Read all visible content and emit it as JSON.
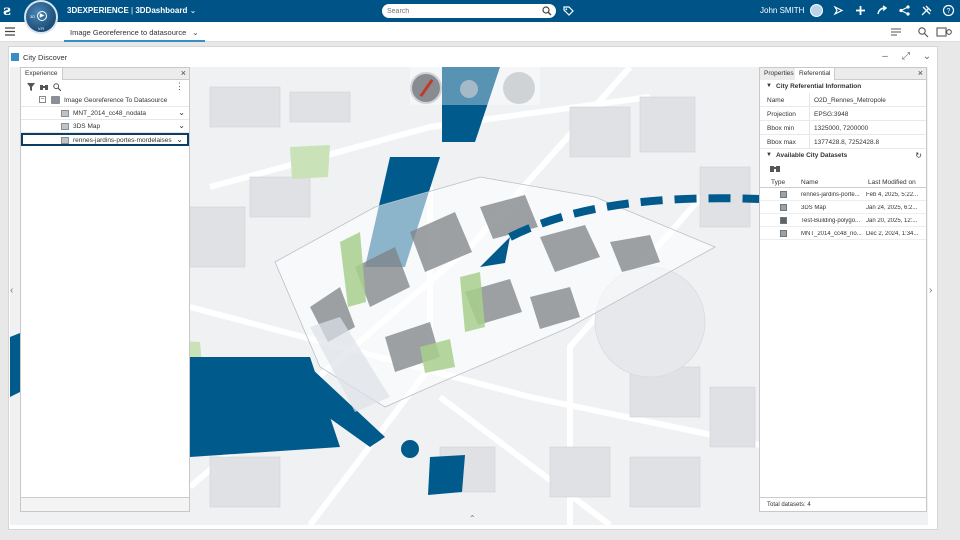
{
  "app": {
    "brand_prefix": "3DEXPERIENCE",
    "brand_separator": " | ",
    "brand_app": "3DDashboard",
    "compass_label": "3D",
    "compass_version": "V.R"
  },
  "search": {
    "placeholder": "Search"
  },
  "user": {
    "name": "John SMITH"
  },
  "dashboard_tab": {
    "label": "Image Georeference to datasource"
  },
  "widget": {
    "title": "City Discover"
  },
  "experience_panel": {
    "tab_label": "Experience",
    "tree": {
      "root": "Image Georeference To Datasource",
      "children": [
        {
          "label": "MNT_2014_cc48_nodata"
        },
        {
          "label": "3DS Map"
        },
        {
          "label": "rennes-jardins-portes-mordelaises"
        }
      ]
    }
  },
  "referential_panel": {
    "tabs": [
      "Properties",
      "Referential"
    ],
    "section_info": "City Referential Information",
    "info": [
      {
        "key": "Name",
        "value": "O2D_Rennes_Metropole"
      },
      {
        "key": "Projection",
        "value": "EPSG:3948"
      },
      {
        "key": "Bbox min",
        "value": "1325000, 7200000"
      },
      {
        "key": "Bbox max",
        "value": "1377428.8, 7252428.8"
      }
    ],
    "section_datasets": "Available City Datasets",
    "columns": [
      "Type",
      "Name",
      "Last Modified on"
    ],
    "datasets": [
      {
        "name": "rennes-jardins-porte...",
        "modified": "Feb 4, 2025, 5:22..."
      },
      {
        "name": "3DS Map",
        "modified": "Jan 24, 2025, 6:2..."
      },
      {
        "name": "Test-Building-polygo...",
        "modified": "Jan 20, 2025, 12:..."
      },
      {
        "name": "MNT_2014_cc48_no...",
        "modified": "Dec 2, 2024, 1:34..."
      }
    ],
    "footer_label": "Total datasets:",
    "footer_count": "4"
  },
  "colors": {
    "topbar": "#005386",
    "accent": "#368ec4",
    "water": "#005a8c"
  }
}
